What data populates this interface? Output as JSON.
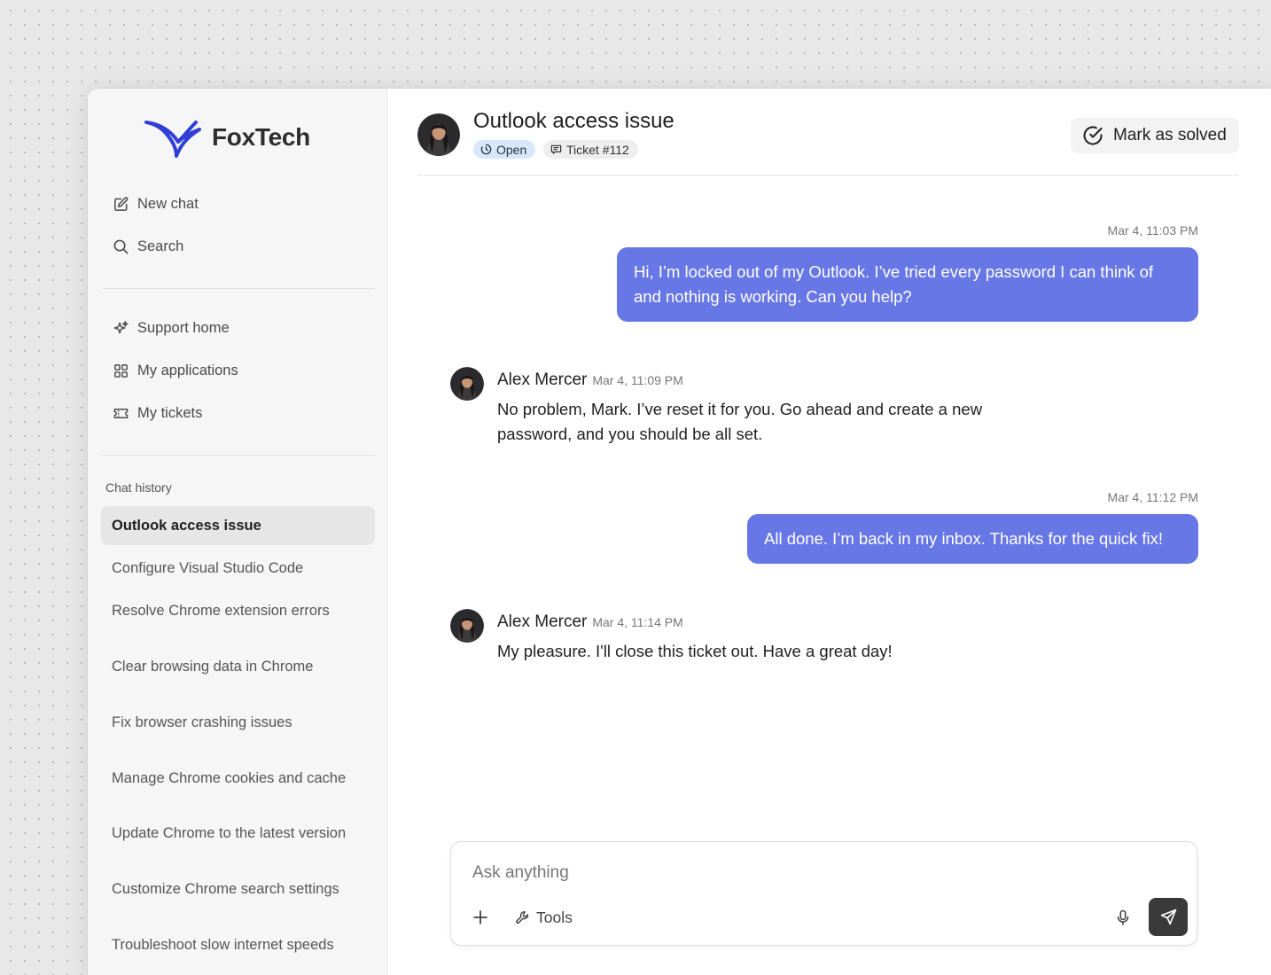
{
  "brand": {
    "name": "FoxTech",
    "accent": "#2f3fd6"
  },
  "sidebar": {
    "top_items": [
      {
        "label": "New chat",
        "icon": "edit-icon"
      },
      {
        "label": "Search",
        "icon": "search-icon"
      }
    ],
    "nav_items": [
      {
        "label": "Support home",
        "icon": "sparkle-icon"
      },
      {
        "label": "My applications",
        "icon": "grid-icon"
      },
      {
        "label": "My tickets",
        "icon": "ticket-icon"
      }
    ],
    "history_title": "Chat history",
    "history": [
      "Outlook access issue",
      "Configure Visual Studio Code",
      "Resolve Chrome extension errors",
      "Clear browsing data in Chrome",
      "Fix browser crashing issues",
      "Manage Chrome cookies and cache",
      "Update Chrome to the latest version",
      "Customize Chrome search settings",
      "Troubleshoot slow internet speeds"
    ],
    "active_history_index": 0
  },
  "header": {
    "title": "Outlook access issue",
    "status": "Open",
    "ticket": "Ticket #112",
    "solve_label": "Mark as solved"
  },
  "messages": [
    {
      "role": "user",
      "time": "Mar 4, 11:03 PM",
      "text": "Hi, I’m locked out of my Outlook. I’ve tried every password I can think of and nothing is working. Can you help?"
    },
    {
      "role": "agent",
      "name": "Alex Mercer",
      "time": "Mar 4, 11:09 PM",
      "text": "No problem, Mark. I’ve reset it for you. Go ahead and create a new password, and you should be all set."
    },
    {
      "role": "user",
      "time": "Mar 4, 11:12 PM",
      "text": "All done. I’m back in my inbox. Thanks for the quick fix!"
    },
    {
      "role": "agent",
      "name": "Alex Mercer",
      "time": "Mar 4, 11:14 PM",
      "text": "My pleasure. I'll close this ticket out. Have a great day!"
    }
  ],
  "composer": {
    "placeholder": "Ask anything",
    "value": "",
    "tools_label": "Tools"
  },
  "colors": {
    "user_bubble": "#6877e6",
    "open_badge": "#d9e7fb",
    "send_button": "#3a3a3a"
  }
}
